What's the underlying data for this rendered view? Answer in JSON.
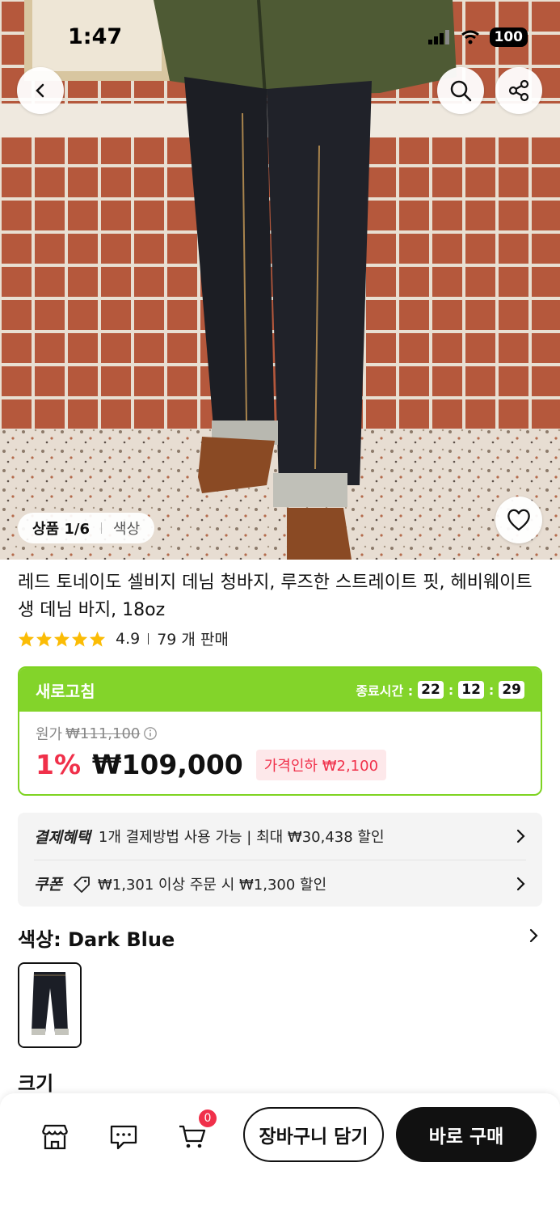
{
  "status": {
    "time": "1:47",
    "battery": "100"
  },
  "gallery": {
    "counter": "상품 1/6",
    "tag": "색상"
  },
  "product": {
    "title": "레드 토네이도 셀비지 데님 청바지, 루즈한 스트레이트 핏, 헤비웨이트 생 데님 바지, 18oz",
    "rating": "4.9",
    "sold": "79 개 판매",
    "stars": 5
  },
  "deal": {
    "label": "새로고침",
    "timer_label": "종료시간 :",
    "hh": "22",
    "mm": "12",
    "ss": "29",
    "orig_label": "원가",
    "orig_price": "₩111,100",
    "discount": "1%",
    "price": "₩109,000",
    "cut": "가격인하 ₩2,100"
  },
  "benefits": {
    "payment_key": "결제혜택",
    "payment_text": "1개 결제방법 사용 가능 | 최대 ₩30,438 할인",
    "coupon_key": "쿠폰",
    "coupon_text": "₩1,301 이상 주문 시 ₩1,300 할인"
  },
  "options": {
    "color_title": "색상: Dark Blue",
    "size_title": "크기"
  },
  "bottom": {
    "cart_count": "0",
    "add_cart": "장바구니 담기",
    "buy_now": "바로 구매"
  },
  "colors": {
    "accent_green": "#83d42a",
    "discount_red": "#f0304a"
  }
}
